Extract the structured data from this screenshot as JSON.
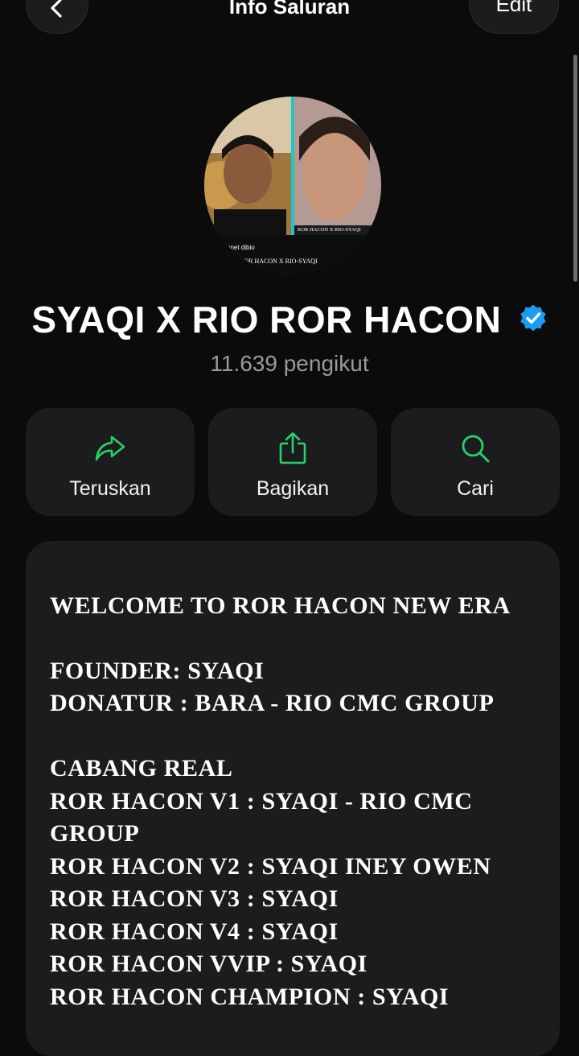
{
  "header": {
    "title": "Info Saluran",
    "back_icon": "chevron-left-icon",
    "edit_label": "Edit"
  },
  "channel": {
    "name": "SYAQI X RIO ROR HACON",
    "verified_icon": "verified-badge-icon",
    "followers": "11.639 pengikut",
    "avatar_caption_left": "onet dibio",
    "avatar_caption_right": "ROR HACON X RIO-SYAQI",
    "avatar_caption_bottom": "ROR HACON X RIO-SYAQI"
  },
  "actions": [
    {
      "label": "Teruskan",
      "icon": "forward-arrow-icon"
    },
    {
      "label": "Bagikan",
      "icon": "share-icon"
    },
    {
      "label": "Cari",
      "icon": "search-icon"
    }
  ],
  "description": {
    "lines": [
      "WELCOME TO ROR HACON NEW ERA",
      "",
      "FOUNDER: SYAQI",
      "DONATUR : BARA - RIO CMC GROUP",
      "",
      "CABANG REAL",
      "ROR HACON V1 : SYAQI - RIO CMC GROUP",
      "ROR HACON V2 : SYAQI INEY OWEN",
      "ROR HACON V3 : SYAQI",
      "ROR HACON V4 : SYAQI",
      "ROR HACON VVIP : SYAQI",
      "ROR HACON CHAMPION : SYAQI"
    ]
  },
  "colors": {
    "background": "#0b0b0b",
    "card": "#1c1c1e",
    "accent_green": "#25d366",
    "verified_blue": "#1d9bf0",
    "muted_text": "#9a9a9a"
  }
}
